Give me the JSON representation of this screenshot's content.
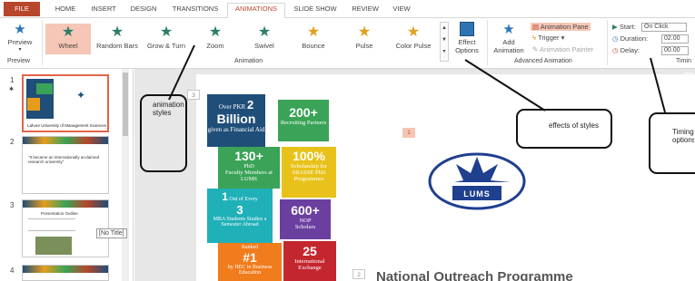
{
  "tabs": {
    "file": "FILE",
    "home": "HOME",
    "insert": "INSERT",
    "design": "DESIGN",
    "transitions": "TRANSITIONS",
    "animations": "ANIMATIONS",
    "slideshow": "SLIDE SHOW",
    "review": "REVIEW",
    "view": "VIEW"
  },
  "ribbon": {
    "preview_label": "Preview",
    "preview_group": "Preview",
    "animation_group": "Animation",
    "advanced_group": "Advanced Animation",
    "timing_group": "Timin",
    "effects": [
      {
        "label": "Wheel",
        "icon": "wheel-star-icon",
        "selected": true
      },
      {
        "label": "Random Bars",
        "icon": "random-bars-star-icon"
      },
      {
        "label": "Grow & Turn",
        "icon": "grow-turn-star-icon"
      },
      {
        "label": "Zoom",
        "icon": "zoom-star-icon"
      },
      {
        "label": "Swivel",
        "icon": "swivel-star-icon"
      },
      {
        "label": "Bounce",
        "icon": "bounce-star-icon"
      },
      {
        "label": "Pulse",
        "icon": "pulse-star-icon"
      },
      {
        "label": "Color Pulse",
        "icon": "color-pulse-star-icon"
      }
    ],
    "effect_options": {
      "line1": "Effect",
      "line2": "Options"
    },
    "add_animation": {
      "line1": "Add",
      "line2": "Animation"
    },
    "animation_pane": "Animation Pane",
    "trigger": "Trigger",
    "animation_painter": "Animation Painter",
    "start_label": "Start:",
    "start_value": "On Click",
    "duration_label": "Duration:",
    "duration_value": "02.00",
    "delay_label": "Delay:",
    "delay_value": "00.00"
  },
  "thumbnails": [
    {
      "num": "1",
      "caption": "Lahore University of Management Sciences"
    },
    {
      "num": "2",
      "caption": "\"It became an internationally acclaimed research university\""
    },
    {
      "num": "3",
      "caption": "Presentation Outline",
      "tooltip": "[No Title]"
    },
    {
      "num": "4",
      "caption": ""
    }
  ],
  "slide": {
    "tiles": [
      {
        "pre": "Over PKR",
        "big": "2",
        "mid": "Billion",
        "post": "given as Financial Aid"
      },
      {
        "big": "200+",
        "post": "Recruiting Partners"
      },
      {
        "big": "130+",
        "mid": "PhD",
        "post": "Faculty Members at LUMS"
      },
      {
        "big": "100%",
        "post": "Scholarship for SBASSE PhD Programmes"
      },
      {
        "pre": "1",
        "mid": "Out of Every",
        "big": "3",
        "post": "MBA Students Studies a Semester Abroad"
      },
      {
        "big": "600+",
        "mid": "NOP",
        "post": "Scholars"
      },
      {
        "pre": "Ranked",
        "big": "#1",
        "post": "by HEC in Business Education"
      },
      {
        "big": "25",
        "post": "International Exchange"
      }
    ],
    "logo_text": "LUMS",
    "bottom_title": "National Outreach Programme",
    "badge1": "1",
    "badge2": "2",
    "badge3": "3"
  },
  "callouts": {
    "animation_styles": "animation styles",
    "effects_of_styles": "effects of styles",
    "timing_options": "Timing options"
  }
}
